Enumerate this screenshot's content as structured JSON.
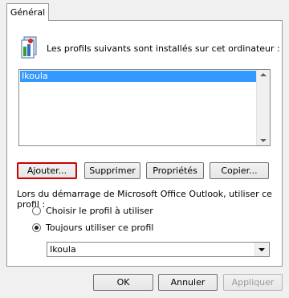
{
  "tab": {
    "label": "Général"
  },
  "header": {
    "icon": "profiles-icon",
    "text": "Les profils suivants sont installés sur cet ordinateur :"
  },
  "profiles": {
    "items": [
      "Ikoula"
    ],
    "selected": "Ikoula"
  },
  "buttons": {
    "add": "Ajouter...",
    "remove": "Supprimer",
    "properties": "Propriétés",
    "copy": "Copier..."
  },
  "startup": {
    "label": "Lors du démarrage de Microsoft Office Outlook, utiliser ce profil :",
    "choose_label": "Choisir le profil à utiliser",
    "always_label": "Toujours utiliser ce profil",
    "selected_profile": "Ikoula"
  },
  "footer": {
    "ok": "OK",
    "cancel": "Annuler",
    "apply": "Appliquer"
  },
  "colors": {
    "selection": "#3399ff",
    "focus_border": "#cc0000"
  }
}
